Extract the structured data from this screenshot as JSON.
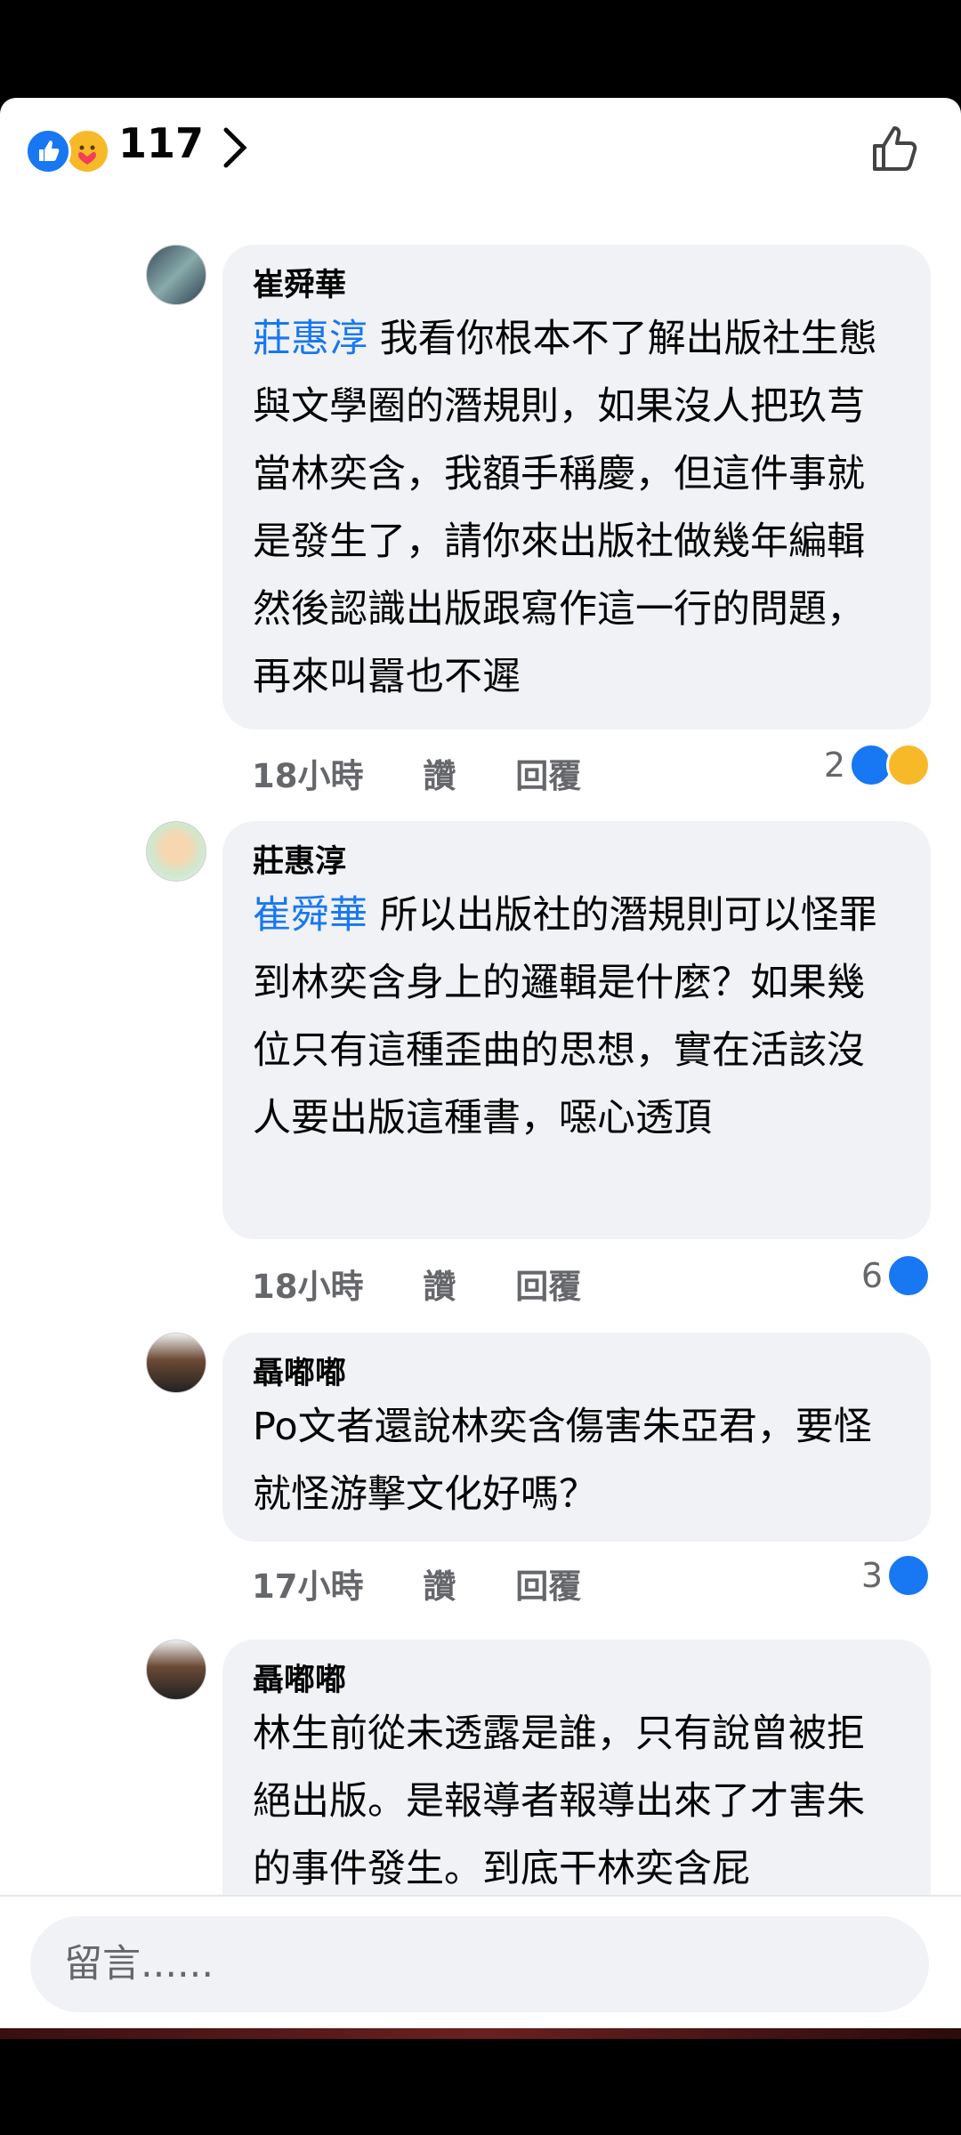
{
  "reactions": {
    "count": "117"
  },
  "comments": [
    {
      "author": "崔舜華",
      "mention": "莊惠淳",
      "text": " 我看你根本不了解出版社生態與文學圈的潛規則，如果沒人把玖芎當林奕含，我額手稱慶，但這件事就是發生了，請你來出版社做幾年編輯然後認識出版跟寫作這一行的問題，再來叫囂也不遲",
      "time": "18小時",
      "like_label": "讚",
      "reply_label": "回覆",
      "reaction_count": "2"
    },
    {
      "author": "莊惠淳",
      "mention": "崔舜華",
      "text": " 所以出版社的潛規則可以怪罪到林奕含身上的邏輯是什麼？如果幾位只有這種歪曲的思想，實在活該沒人要出版這種書，噁心透頂",
      "time": "18小時",
      "like_label": "讚",
      "reply_label": "回覆",
      "reaction_count": "6"
    },
    {
      "author": "聶嘟嘟",
      "mention": "",
      "text": "Po文者還說林奕含傷害朱亞君，要怪就怪游擊文化好嗎？",
      "time": "17小時",
      "like_label": "讚",
      "reply_label": "回覆",
      "reaction_count": "3"
    },
    {
      "author": "聶嘟嘟",
      "mention": "",
      "text": "林生前從未透露是誰，只有說曾被拒絕出版。是報導者報導出來了才害朱的事件發生。到底干林奕含屁",
      "time": "",
      "like_label": "",
      "reply_label": "",
      "reaction_count": ""
    }
  ],
  "composer": {
    "placeholder": "留言......"
  },
  "colors": {
    "accent": "#1877f2",
    "bubble": "#f0f2f5",
    "meta": "#65676b"
  }
}
